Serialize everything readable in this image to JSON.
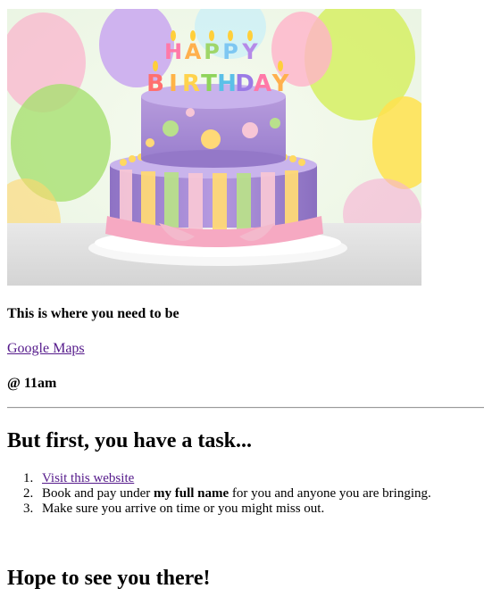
{
  "hero_image": {
    "candle_letters_top": [
      "H",
      "A",
      "P",
      "P",
      "Y"
    ],
    "candle_letters_bottom": [
      "B",
      "I",
      "R",
      "T",
      "H",
      "D",
      "A",
      "Y"
    ]
  },
  "location": {
    "heading": "This is where you need to be",
    "maps_link": "Google Maps",
    "time": "@ 11am"
  },
  "task": {
    "heading": "But first, you have a task...",
    "steps": [
      {
        "num": "1.",
        "link": "Visit this website"
      },
      {
        "num": "2.",
        "pre": "Book and pay under ",
        "bold": "my full name",
        "post": " for you and anyone you are bringing."
      },
      {
        "num": "3.",
        "text": "Make sure you arrive on time or you might miss out."
      }
    ]
  },
  "closing": {
    "heading": "Hope to see you there!"
  },
  "colors": {
    "link_visited": "#551a8b",
    "rule": "#999999"
  }
}
